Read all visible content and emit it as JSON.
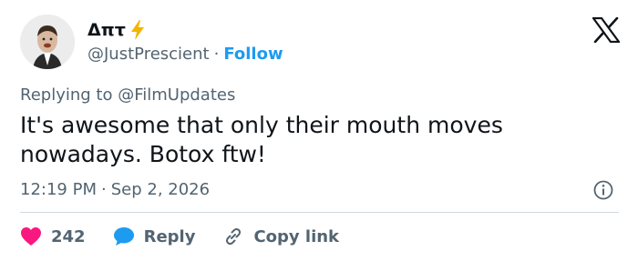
{
  "author": {
    "display_name": "Δπτ",
    "handle": "@JustPrescient",
    "separator": "·",
    "follow_label": "Follow"
  },
  "reply_context": {
    "prefix": "Replying to ",
    "mention": "@FilmUpdates"
  },
  "tweet": {
    "text": "It's awesome that only their mouth moves nowadays. Botox ftw!",
    "time": "12:19 PM",
    "separator": "·",
    "date": "Sep 2, 2026"
  },
  "actions": {
    "like_count": "242",
    "reply_label": "Reply",
    "copy_label": "Copy link"
  },
  "colors": {
    "accent": "#1d9bf0",
    "like": "#f91880",
    "muted": "#536471",
    "text": "#0f1419"
  },
  "icons": {
    "brand": "x-logo-icon",
    "emoji": "lightning-bolt-icon",
    "info": "info-icon",
    "like": "heart-icon",
    "reply": "chat-bubble-icon",
    "copy": "link-icon"
  }
}
